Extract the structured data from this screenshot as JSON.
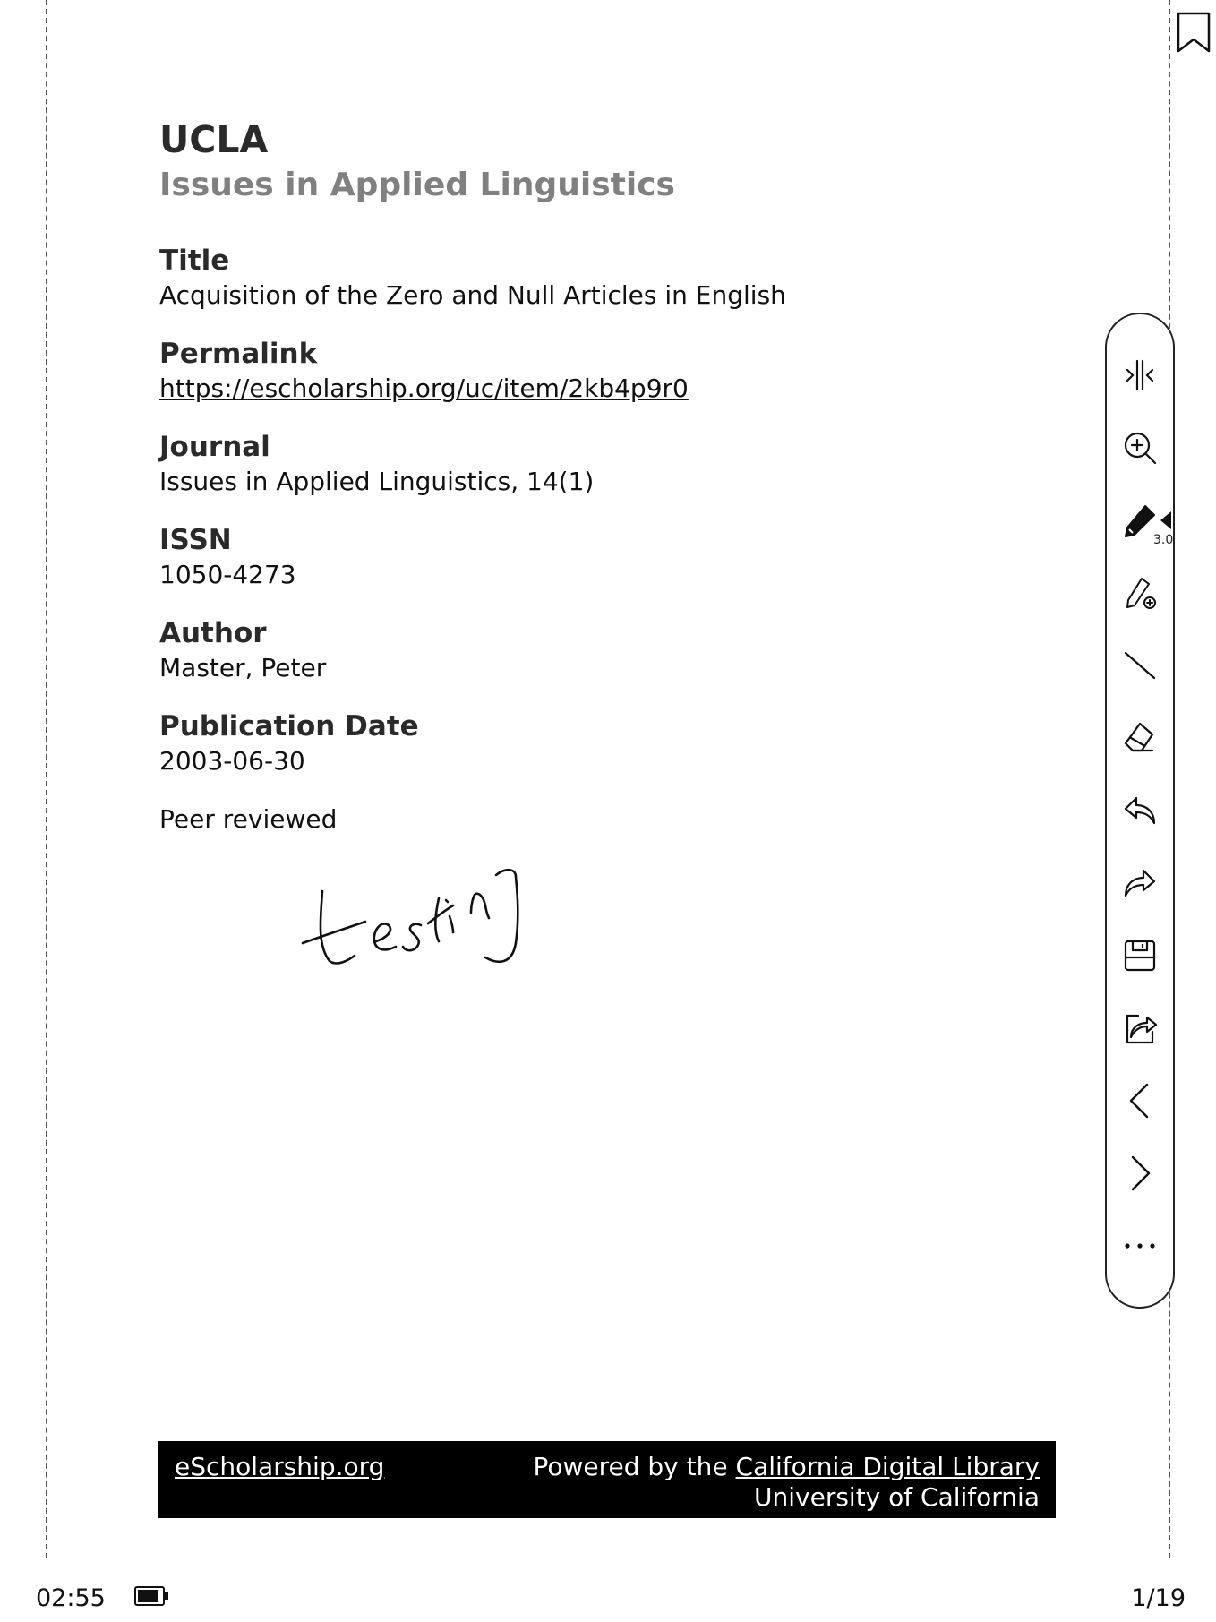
{
  "document": {
    "publisher": "UCLA",
    "journal_heading": "Issues in Applied Linguistics",
    "fields": [
      {
        "label": "Title",
        "value": "Acquisition of the Zero and Null Articles in English"
      },
      {
        "label": "Permalink",
        "value": "https://escholarship.org/uc/item/2kb4p9r0"
      },
      {
        "label": "Journal",
        "value": "Issues in Applied Linguistics, 14(1)"
      },
      {
        "label": "ISSN",
        "value": "1050-4273"
      },
      {
        "label": "Author",
        "value": "Master, Peter"
      },
      {
        "label": "Publication Date",
        "value": "2003-06-30"
      }
    ],
    "peer_reviewed": "Peer reviewed",
    "handwritten_annotation": "testing"
  },
  "footer": {
    "left_link": "eScholarship.org",
    "powered_by": "Powered by the ",
    "cdl_link": "California Digital Library",
    "university": "University of California"
  },
  "toolbar": {
    "tools": [
      {
        "name": "split-view-icon"
      },
      {
        "name": "zoom-in-icon"
      },
      {
        "name": "pen-icon"
      },
      {
        "name": "pen-add-icon"
      },
      {
        "name": "line-icon"
      },
      {
        "name": "eraser-icon"
      },
      {
        "name": "undo-icon"
      },
      {
        "name": "redo-icon"
      },
      {
        "name": "save-icon"
      },
      {
        "name": "share-icon"
      },
      {
        "name": "previous-page-icon"
      },
      {
        "name": "next-page-icon"
      },
      {
        "name": "more-icon"
      }
    ],
    "pen_size": "3.0"
  },
  "status_bar": {
    "time": "02:55",
    "battery_level": 0.85,
    "page_indicator": "1/19"
  }
}
